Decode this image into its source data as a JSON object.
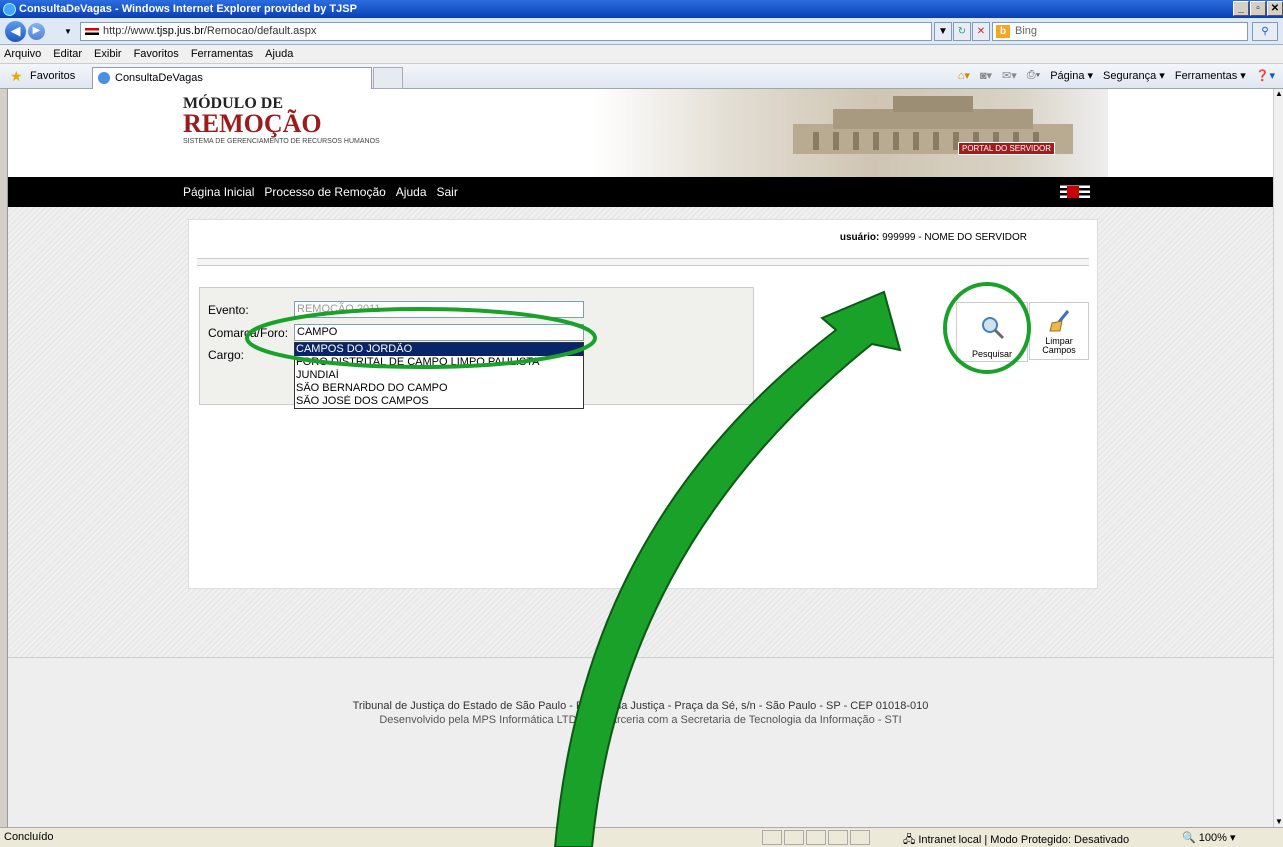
{
  "window": {
    "title": "ConsultaDeVagas - Windows Internet Explorer provided by TJSP"
  },
  "address": {
    "url_prefix": "http://www.",
    "url_domain": "tjsp.jus.br",
    "url_path": "/Remocao/default.aspx",
    "search_placeholder": "Bing"
  },
  "menu": [
    "Arquivo",
    "Editar",
    "Exibir",
    "Favoritos",
    "Ferramentas",
    "Ajuda"
  ],
  "favorites": {
    "label": "Favoritos",
    "tab_title": "ConsultaDeVagas",
    "commands": [
      "Página ▾",
      "Segurança ▾",
      "Ferramentas ▾"
    ]
  },
  "site": {
    "title_line1": "MÓDULO DE",
    "title_line2": "REMOÇÃO",
    "subtitle": "SISTEMA DE GERENCIAMENTO DE RECURSOS HUMANOS",
    "portal_badge": "PORTAL DO SERVIDOR",
    "nav": [
      "Página Inicial",
      "Processo de Remoção",
      "Ajuda",
      "Sair"
    ]
  },
  "user": {
    "label": "usuário:",
    "value": "999999 - NOME DO SERVIDOR"
  },
  "form": {
    "evento_label": "Evento:",
    "evento_value": "REMOÇÃO 2011",
    "comarca_label": "Comarca/Foro:",
    "comarca_value": "CAMPO",
    "cargo_label": "Cargo:",
    "options": [
      "CAMPOS DO JORDÃO",
      "FORO DISTRITAL DE CAMPO LIMPO PAULISTA",
      "JUNDIAÍ",
      "SÃO BERNARDO DO CAMPO",
      "SÃO JOSÉ DOS CAMPOS"
    ],
    "selected_option": "CAMPOS DO JORDÃO"
  },
  "buttons": {
    "search": "Pesquisar",
    "clear_line1": "Limpar",
    "clear_line2": "Campos"
  },
  "footer": {
    "line1": "Tribunal de Justiça do Estado de São Paulo - Palácio da Justiça - Praça da Sé, s/n - São Paulo - SP - CEP 01018-010",
    "line2": "Desenvolvido pela MPS Informática LTDA em parceria com a Secretaria de Tecnologia da Informação - STI"
  },
  "status": {
    "left": "Concluído",
    "zone": "Intranet local | Modo Protegido: Desativado",
    "zoom": "100%"
  },
  "colors": {
    "annotation": "#1aa12a",
    "brand_red": "#9b1c1c",
    "selection": "#0a246a"
  }
}
